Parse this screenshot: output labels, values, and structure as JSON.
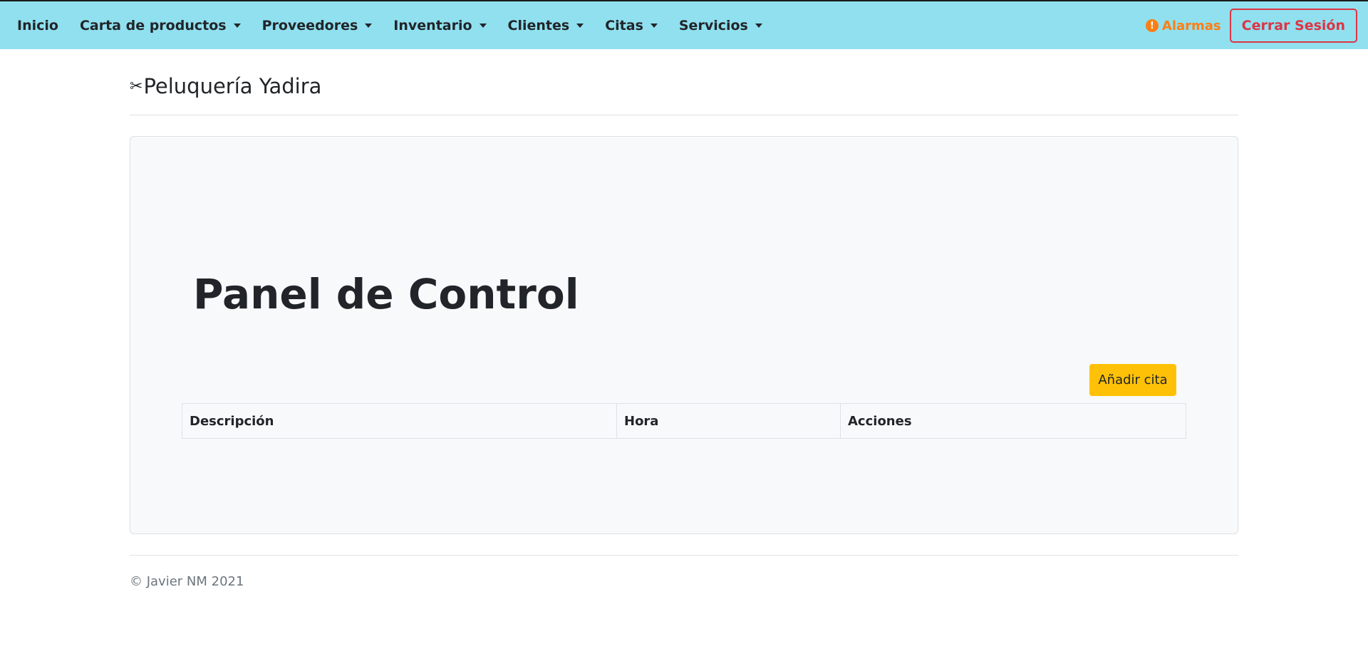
{
  "navbar": {
    "items": [
      {
        "label": "Inicio",
        "dropdown": false
      },
      {
        "label": "Carta de productos",
        "dropdown": true
      },
      {
        "label": "Proveedores",
        "dropdown": true
      },
      {
        "label": "Inventario",
        "dropdown": true
      },
      {
        "label": "Clientes",
        "dropdown": true
      },
      {
        "label": "Citas",
        "dropdown": true
      },
      {
        "label": "Servicios",
        "dropdown": true
      }
    ],
    "alarm_icon": "!",
    "alarm_label": "Alarmas",
    "logout_label": "Cerrar Sesión"
  },
  "brand": {
    "icon": "✂",
    "name": "Peluquería Yadira"
  },
  "panel": {
    "title": "Panel de Control",
    "add_button": "Añadir cita",
    "table": {
      "headers": [
        "Descripción",
        "Hora",
        "Acciones"
      ],
      "rows": []
    }
  },
  "footer": {
    "text": "© Javier NM 2021"
  },
  "colors": {
    "navbar_bg": "#90e0ef",
    "alarm": "#fd7e14",
    "logout": "#dc3545",
    "add_button": "#ffc107",
    "panel_bg": "#f8f9fa"
  }
}
